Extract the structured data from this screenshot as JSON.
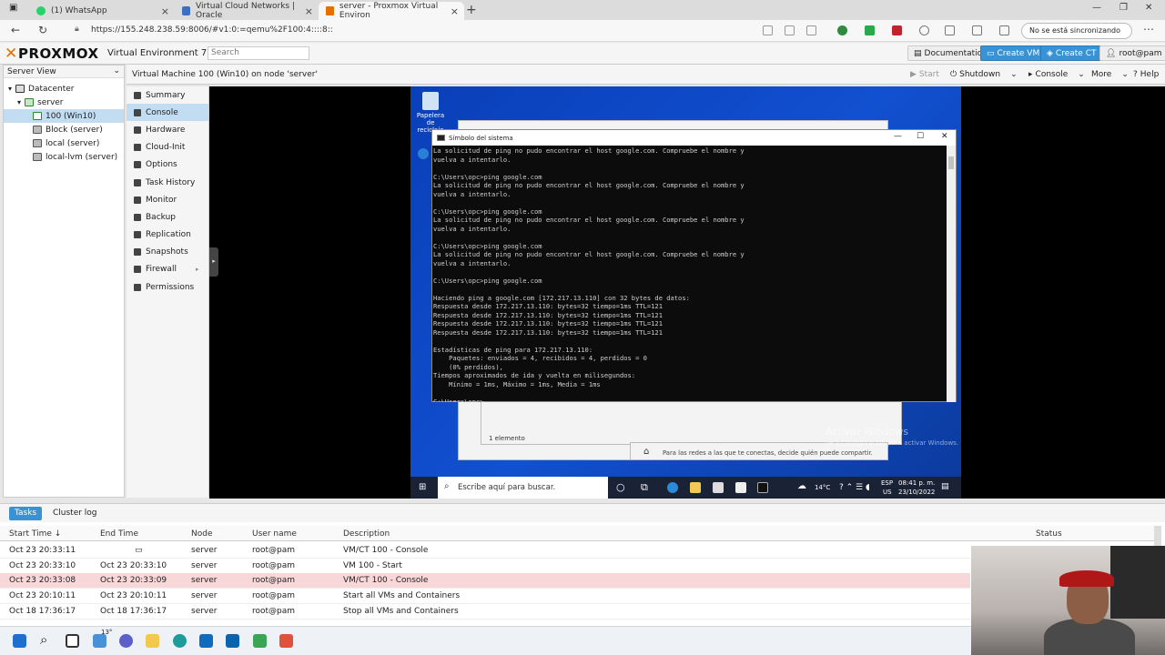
{
  "browser": {
    "tabs": [
      {
        "label": "(1) WhatsApp"
      },
      {
        "label": "Virtual Cloud Networks | Oracle"
      },
      {
        "label": "server - Proxmox Virtual Environ"
      }
    ],
    "url": "https://155.248.238.59:8006/#v1:0:=qemu%2F100:4::::8::",
    "sync_label": "No se está sincronizando",
    "colors": {
      "whatsapp": "#25d366",
      "oracle": "#3b6fc4",
      "proxmox": "#e57000"
    }
  },
  "pve": {
    "logo": "PROXMOX",
    "version": "Virtual Environment 7.1-7",
    "search_placeholder": "Search",
    "header_buttons": {
      "documentation": "Documentation",
      "create_vm": "Create VM",
      "create_ct": "Create CT",
      "user": "root@pam"
    },
    "accent": "#3892d4"
  },
  "tree": {
    "view": "Server View",
    "items": [
      {
        "label": "Datacenter"
      },
      {
        "label": "server"
      },
      {
        "label": "100 (Win10)"
      },
      {
        "label": "Block (server)"
      },
      {
        "label": "local (server)"
      },
      {
        "label": "local-lvm (server)"
      }
    ]
  },
  "vm": {
    "title": "Virtual Machine 100 (Win10) on node 'server'",
    "actions": {
      "start": "Start",
      "shutdown": "Shutdown",
      "console": "Console",
      "more": "More",
      "help": "Help"
    },
    "menu": [
      {
        "label": "Summary"
      },
      {
        "label": "Console"
      },
      {
        "label": "Hardware"
      },
      {
        "label": "Cloud-Init"
      },
      {
        "label": "Options"
      },
      {
        "label": "Task History"
      },
      {
        "label": "Monitor"
      },
      {
        "label": "Backup"
      },
      {
        "label": "Replication"
      },
      {
        "label": "Snapshots"
      },
      {
        "label": "Firewall"
      },
      {
        "label": "Permissions"
      }
    ]
  },
  "guest": {
    "recycle_bin": "Papelera de reciclaje",
    "cmd_title": "Símbolo del sistema",
    "cmd_text": "La solicitud de ping no pudo encontrar el host google.com. Compruebe el nombre y\nvuelva a intentarlo.\n\nC:\\Users\\opc>ping google.com\nLa solicitud de ping no pudo encontrar el host google.com. Compruebe el nombre y\nvuelva a intentarlo.\n\nC:\\Users\\opc>ping google.com\nLa solicitud de ping no pudo encontrar el host google.com. Compruebe el nombre y\nvuelva a intentarlo.\n\nC:\\Users\\opc>ping google.com\nLa solicitud de ping no pudo encontrar el host google.com. Compruebe el nombre y\nvuelva a intentarlo.\n\nC:\\Users\\opc>ping google.com\n\nHaciendo ping a google.com [172.217.13.110] con 32 bytes de datos:\nRespuesta desde 172.217.13.110: bytes=32 tiempo=1ms TTL=121\nRespuesta desde 172.217.13.110: bytes=32 tiempo=1ms TTL=121\nRespuesta desde 172.217.13.110: bytes=32 tiempo=1ms TTL=121\nRespuesta desde 172.217.13.110: bytes=32 tiempo=1ms TTL=121\n\nEstadísticas de ping para 172.217.13.110:\n    Paquetes: enviados = 4, recibidos = 4, perdidos = 0\n    (0% perdidos),\nTiempos aproximados de ida y vuelta en milisegundos:\n    Mínimo = 1ms, Máximo = 1ms, Media = 1ms\n\nC:\\Users\\opc>_",
    "explorer_count": "1 elemento",
    "network_note": "Para las redes a las que te conectas, decide quién puede compartir.",
    "activate_title": "Activar Windows",
    "activate_sub": "Ve a Configuración para activar Windows.",
    "search_placeholder": "Escribe aquí para buscar.",
    "weather": "14°C",
    "lang": "ESP",
    "region": "US",
    "time": "08:41 p. m.",
    "date": "23/10/2022"
  },
  "tasks": {
    "tabs": {
      "tasks": "Tasks",
      "cluster_log": "Cluster log"
    },
    "columns": [
      "Start Time ↓",
      "End Time",
      "Node",
      "User name",
      "Description",
      "Status"
    ],
    "rows": [
      {
        "start": "Oct 23 20:33:11",
        "end": "",
        "node": "server",
        "user": "root@pam",
        "desc": "VM/CT 100 - Console",
        "running": true
      },
      {
        "start": "Oct 23 20:33:10",
        "end": "Oct 23 20:33:10",
        "node": "server",
        "user": "root@pam",
        "desc": "VM 100 - Start"
      },
      {
        "start": "Oct 23 20:33:08",
        "end": "Oct 23 20:33:09",
        "node": "server",
        "user": "root@pam",
        "desc": "VM/CT 100 - Console",
        "error": true
      },
      {
        "start": "Oct 23 20:10:11",
        "end": "Oct 23 20:10:11",
        "node": "server",
        "user": "root@pam",
        "desc": "Start all VMs and Containers"
      },
      {
        "start": "Oct 18 17:36:17",
        "end": "Oct 18 17:36:17",
        "node": "server",
        "user": "root@pam",
        "desc": "Stop all VMs and Containers"
      }
    ]
  },
  "host_taskbar": {
    "weather_badge": "13°"
  }
}
